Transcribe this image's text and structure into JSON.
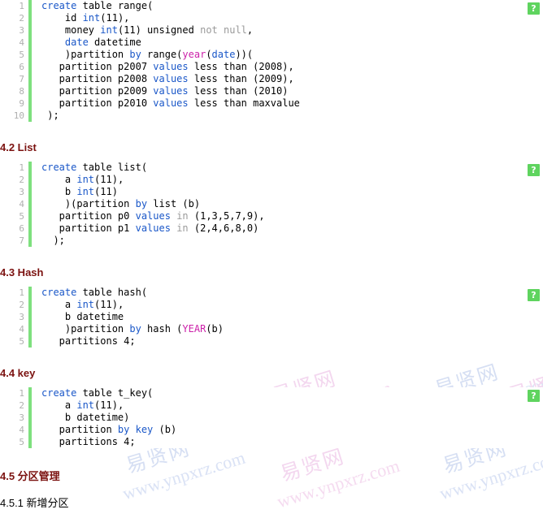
{
  "document": {
    "language": "sql",
    "watermark": {
      "cn_text": "易贤网",
      "url_text": "www.ynpxrz.com",
      "pink": "#f3d7ef",
      "blue": "#d6dff3"
    },
    "badge": {
      "glyph": "?",
      "color": "#5fd45f",
      "label": "broken-image-placeholder"
    },
    "heading_color": "#7b1210",
    "blocks": [
      {
        "id": "range",
        "line_numbers": [
          "1",
          "2",
          "3",
          "4",
          "5",
          "6",
          "7",
          "8",
          "9",
          "10"
        ],
        "lines": [
          [
            {
              "t": "create",
              "c": "kw"
            },
            {
              "t": " ",
              "c": "pl"
            },
            {
              "t": "table",
              "c": "pl"
            },
            {
              "t": " range(",
              "c": "pl"
            }
          ],
          [
            {
              "t": "    id ",
              "c": "pl"
            },
            {
              "t": "int",
              "c": "kw"
            },
            {
              "t": "(11),",
              "c": "pl"
            }
          ],
          [
            {
              "t": "    money ",
              "c": "pl"
            },
            {
              "t": "int",
              "c": "kw"
            },
            {
              "t": "(11) unsigned ",
              "c": "pl"
            },
            {
              "t": "not null",
              "c": "dim"
            },
            {
              "t": ",",
              "c": "pl"
            }
          ],
          [
            {
              "t": "    ",
              "c": "pl"
            },
            {
              "t": "date",
              "c": "kw"
            },
            {
              "t": " datetime",
              "c": "pl"
            }
          ],
          [
            {
              "t": "    )partition ",
              "c": "pl"
            },
            {
              "t": "by",
              "c": "kw"
            },
            {
              "t": " range(",
              "c": "pl"
            },
            {
              "t": "year",
              "c": "fn"
            },
            {
              "t": "(",
              "c": "pl"
            },
            {
              "t": "date",
              "c": "kw"
            },
            {
              "t": "))(",
              "c": "pl"
            }
          ],
          [
            {
              "t": "   partition p2007 ",
              "c": "pl"
            },
            {
              "t": "values",
              "c": "kw"
            },
            {
              "t": " less than (2008),",
              "c": "pl"
            }
          ],
          [
            {
              "t": "   partition p2008 ",
              "c": "pl"
            },
            {
              "t": "values",
              "c": "kw"
            },
            {
              "t": " less than (2009),",
              "c": "pl"
            }
          ],
          [
            {
              "t": "   partition p2009 ",
              "c": "pl"
            },
            {
              "t": "values",
              "c": "kw"
            },
            {
              "t": " less than (2010)",
              "c": "pl"
            }
          ],
          [
            {
              "t": "   partition p2010 ",
              "c": "pl"
            },
            {
              "t": "values",
              "c": "kw"
            },
            {
              "t": " less than maxvalue",
              "c": "pl"
            }
          ],
          [
            {
              "t": " );",
              "c": "pl"
            }
          ]
        ]
      },
      {
        "id": "list",
        "line_numbers": [
          "1",
          "2",
          "3",
          "4",
          "5",
          "6",
          "7"
        ],
        "lines": [
          [
            {
              "t": "create",
              "c": "kw"
            },
            {
              "t": " table list(",
              "c": "pl"
            }
          ],
          [
            {
              "t": "    a ",
              "c": "pl"
            },
            {
              "t": "int",
              "c": "kw"
            },
            {
              "t": "(11),",
              "c": "pl"
            }
          ],
          [
            {
              "t": "    b ",
              "c": "pl"
            },
            {
              "t": "int",
              "c": "kw"
            },
            {
              "t": "(11)",
              "c": "pl"
            }
          ],
          [
            {
              "t": "    )(partition ",
              "c": "pl"
            },
            {
              "t": "by",
              "c": "kw"
            },
            {
              "t": " list (b)",
              "c": "pl"
            }
          ],
          [
            {
              "t": "   partition p0 ",
              "c": "pl"
            },
            {
              "t": "values",
              "c": "kw"
            },
            {
              "t": " ",
              "c": "pl"
            },
            {
              "t": "in",
              "c": "dim"
            },
            {
              "t": " (1,3,5,7,9),",
              "c": "pl"
            }
          ],
          [
            {
              "t": "   partition p1 ",
              "c": "pl"
            },
            {
              "t": "values",
              "c": "kw"
            },
            {
              "t": " ",
              "c": "pl"
            },
            {
              "t": "in",
              "c": "dim"
            },
            {
              "t": " (2,4,6,8,0)",
              "c": "pl"
            }
          ],
          [
            {
              "t": "  );",
              "c": "pl"
            }
          ]
        ]
      },
      {
        "id": "hash",
        "line_numbers": [
          "1",
          "2",
          "3",
          "4",
          "5"
        ],
        "lines": [
          [
            {
              "t": "create",
              "c": "kw"
            },
            {
              "t": " table hash(",
              "c": "pl"
            }
          ],
          [
            {
              "t": "    a ",
              "c": "pl"
            },
            {
              "t": "int",
              "c": "kw"
            },
            {
              "t": "(11),",
              "c": "pl"
            }
          ],
          [
            {
              "t": "    b datetime",
              "c": "pl"
            }
          ],
          [
            {
              "t": "    )partition ",
              "c": "pl"
            },
            {
              "t": "by",
              "c": "kw"
            },
            {
              "t": " hash (",
              "c": "pl"
            },
            {
              "t": "YEAR",
              "c": "fn"
            },
            {
              "t": "(b)",
              "c": "pl"
            }
          ],
          [
            {
              "t": "   partitions 4;",
              "c": "pl"
            }
          ]
        ]
      },
      {
        "id": "t_key",
        "line_numbers": [
          "1",
          "2",
          "3",
          "4",
          "5"
        ],
        "lines": [
          [
            {
              "t": "create",
              "c": "kw"
            },
            {
              "t": " table t_key(",
              "c": "pl"
            }
          ],
          [
            {
              "t": "    a ",
              "c": "pl"
            },
            {
              "t": "int",
              "c": "kw"
            },
            {
              "t": "(11),",
              "c": "pl"
            }
          ],
          [
            {
              "t": "    b datetime)",
              "c": "pl"
            }
          ],
          [
            {
              "t": "   partition ",
              "c": "pl"
            },
            {
              "t": "by",
              "c": "kw"
            },
            {
              "t": " ",
              "c": "pl"
            },
            {
              "t": "key",
              "c": "kw"
            },
            {
              "t": " (b)",
              "c": "pl"
            }
          ],
          [
            {
              "t": "   partitions 4;",
              "c": "pl"
            }
          ]
        ]
      }
    ],
    "headings": {
      "list": "4.2 List",
      "hash": "4.3 Hash",
      "key": "4.4 key",
      "partition_mgmt": "4.5 分区管理",
      "add_partition": "4.5.1 新增分区"
    }
  }
}
